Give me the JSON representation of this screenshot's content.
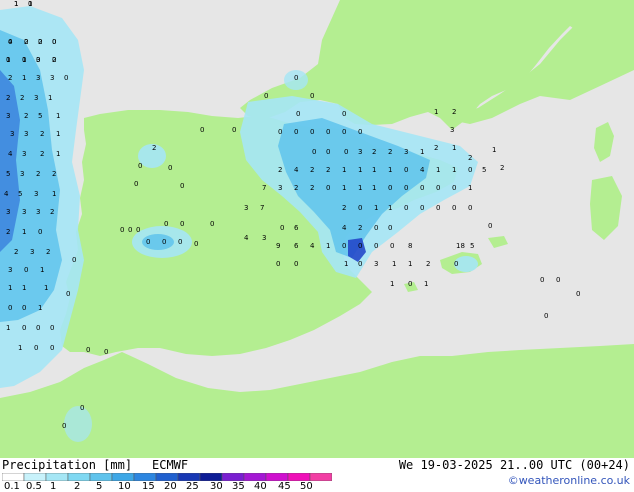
{
  "title": {
    "product": "Precipitation [mm]",
    "model": "ECMWF",
    "valid_time": "We 19-03-2025 21..00 UTC (00+24)"
  },
  "credit": "©weatheronline.co.uk",
  "colors": {
    "sea": "#e6e6e6",
    "land": "#b4ee91",
    "precip_light": "#a5e6f5",
    "precip_mid": "#5fc3ec",
    "precip_heavy": "#3a7fdc",
    "precip_core": "#2448c9"
  },
  "legend": {
    "ticks": [
      "0.1",
      "0.5",
      "1",
      "2",
      "5",
      "10",
      "15",
      "20",
      "25",
      "30",
      "35",
      "40",
      "45",
      "50"
    ],
    "colors": [
      "#ffffff",
      "#c8f2fb",
      "#a5e6f5",
      "#7fd8f2",
      "#5fc3ec",
      "#3da7e6",
      "#2d86e0",
      "#2060cf",
      "#1838b4",
      "#0e1d96",
      "#7a1fd1",
      "#a418d4",
      "#cf10cf",
      "#ef10b8",
      "#f23ea4"
    ]
  },
  "grid_values": [
    {
      "v": "1"
    },
    {
      "v": "0"
    },
    {
      "v": "4"
    },
    {
      "v": "2"
    },
    {
      "v": "2"
    },
    {
      "v": "0"
    },
    {
      "v": "1"
    },
    {
      "v": "1"
    },
    {
      "v": "3"
    },
    {
      "v": "2"
    },
    {
      "v": "2"
    },
    {
      "v": "1"
    },
    {
      "v": "3"
    },
    {
      "v": "3"
    },
    {
      "v": "0"
    },
    {
      "v": "2"
    },
    {
      "v": "2"
    },
    {
      "v": "3"
    },
    {
      "v": "1"
    },
    {
      "v": "3"
    },
    {
      "v": "2"
    },
    {
      "v": "5"
    },
    {
      "v": "1"
    },
    {
      "v": "3"
    },
    {
      "v": "3"
    },
    {
      "v": "2"
    },
    {
      "v": "1"
    },
    {
      "v": "4"
    },
    {
      "v": "3"
    },
    {
      "v": "2"
    },
    {
      "v": "1"
    },
    {
      "v": "5"
    },
    {
      "v": "3"
    },
    {
      "v": "2"
    },
    {
      "v": "2"
    },
    {
      "v": "4"
    },
    {
      "v": "5"
    },
    {
      "v": "3"
    },
    {
      "v": "1"
    },
    {
      "v": "3"
    },
    {
      "v": "3"
    },
    {
      "v": "3"
    },
    {
      "v": "2"
    },
    {
      "v": "2"
    },
    {
      "v": "1"
    },
    {
      "v": "0"
    },
    {
      "v": "2"
    },
    {
      "v": "3"
    },
    {
      "v": "2"
    },
    {
      "v": "3"
    },
    {
      "v": "0"
    },
    {
      "v": "1"
    },
    {
      "v": "1"
    },
    {
      "v": "1"
    },
    {
      "v": "1"
    },
    {
      "v": "0"
    },
    {
      "v": "0"
    },
    {
      "v": "1"
    },
    {
      "v": "1"
    },
    {
      "v": "0"
    },
    {
      "v": "0"
    },
    {
      "v": "0"
    },
    {
      "v": "1"
    },
    {
      "v": "0"
    },
    {
      "v": "0"
    },
    {
      "v": "2"
    },
    {
      "v": "0"
    },
    {
      "v": "0"
    },
    {
      "v": "0"
    },
    {
      "v": "0"
    },
    {
      "v": "0"
    },
    {
      "v": "0"
    },
    {
      "v": "0"
    },
    {
      "v": "0"
    },
    {
      "v": "0"
    },
    {
      "v": "0"
    },
    {
      "v": "0"
    },
    {
      "v": "0"
    },
    {
      "v": "0"
    },
    {
      "v": "0"
    },
    {
      "v": "0"
    },
    {
      "v": "0"
    },
    {
      "v": "0"
    },
    {
      "v": "0"
    },
    {
      "v": "0"
    },
    {
      "v": "0"
    },
    {
      "v": "0"
    },
    {
      "v": "0"
    },
    {
      "v": "0"
    },
    {
      "v": "0"
    },
    {
      "v": "0"
    },
    {
      "v": "3"
    },
    {
      "v": "2"
    },
    {
      "v": "2"
    },
    {
      "v": "3"
    },
    {
      "v": "1"
    },
    {
      "v": "2"
    },
    {
      "v": "1"
    },
    {
      "v": "2"
    },
    {
      "v": "4"
    },
    {
      "v": "2"
    },
    {
      "v": "2"
    },
    {
      "v": "1"
    },
    {
      "v": "1"
    },
    {
      "v": "1"
    },
    {
      "v": "1"
    },
    {
      "v": "0"
    },
    {
      "v": "4"
    },
    {
      "v": "1"
    },
    {
      "v": "1"
    },
    {
      "v": "0"
    },
    {
      "v": "5"
    },
    {
      "v": "7"
    },
    {
      "v": "3"
    },
    {
      "v": "2"
    },
    {
      "v": "2"
    },
    {
      "v": "0"
    },
    {
      "v": "1"
    },
    {
      "v": "1"
    },
    {
      "v": "1"
    },
    {
      "v": "0"
    },
    {
      "v": "0"
    },
    {
      "v": "0"
    },
    {
      "v": "0"
    },
    {
      "v": "0"
    },
    {
      "v": "1"
    },
    {
      "v": "3"
    },
    {
      "v": "7"
    },
    {
      "v": "2"
    },
    {
      "v": "0"
    },
    {
      "v": "1"
    },
    {
      "v": "1"
    },
    {
      "v": "0"
    },
    {
      "v": "0"
    },
    {
      "v": "0"
    },
    {
      "v": "0"
    },
    {
      "v": "0"
    },
    {
      "v": "0"
    },
    {
      "v": "6"
    },
    {
      "v": "4"
    },
    {
      "v": "2"
    },
    {
      "v": "0"
    },
    {
      "v": "0"
    },
    {
      "v": "4"
    },
    {
      "v": "3"
    },
    {
      "v": "9"
    },
    {
      "v": "6"
    },
    {
      "v": "4"
    },
    {
      "v": "1"
    },
    {
      "v": "0"
    },
    {
      "v": "0"
    },
    {
      "v": "0"
    },
    {
      "v": "0"
    },
    {
      "v": "8"
    },
    {
      "v": "18"
    },
    {
      "v": "5"
    },
    {
      "v": "1"
    },
    {
      "v": "0"
    },
    {
      "v": "3"
    },
    {
      "v": "1"
    },
    {
      "v": "1"
    },
    {
      "v": "2"
    },
    {
      "v": "1"
    },
    {
      "v": "0"
    },
    {
      "v": "1"
    },
    {
      "v": "0"
    },
    {
      "v": "0"
    },
    {
      "v": "2"
    },
    {
      "v": "0"
    },
    {
      "v": "0"
    },
    {
      "v": "0"
    },
    {
      "v": "0"
    },
    {
      "v": "0"
    },
    {
      "v": "0"
    },
    {
      "v": "0"
    },
    {
      "v": "0"
    },
    {
      "v": "0"
    },
    {
      "v": "0"
    },
    {
      "v": "0"
    },
    {
      "v": "0"
    },
    {
      "v": "0"
    },
    {
      "v": "0"
    },
    {
      "v": "0"
    },
    {
      "v": "0"
    },
    {
      "v": "0"
    },
    {
      "v": "1"
    },
    {
      "v": "2"
    },
    {
      "v": "3"
    },
    {
      "v": "2"
    },
    {
      "v": "1"
    },
    {
      "v": "1"
    },
    {
      "v": "1"
    },
    {
      "v": "0"
    },
    {
      "v": "0"
    },
    {
      "v": "0"
    },
    {
      "v": "0"
    },
    {
      "v": "0"
    },
    {
      "v": "0"
    },
    {
      "v": "0"
    },
    {
      "v": "0"
    }
  ]
}
